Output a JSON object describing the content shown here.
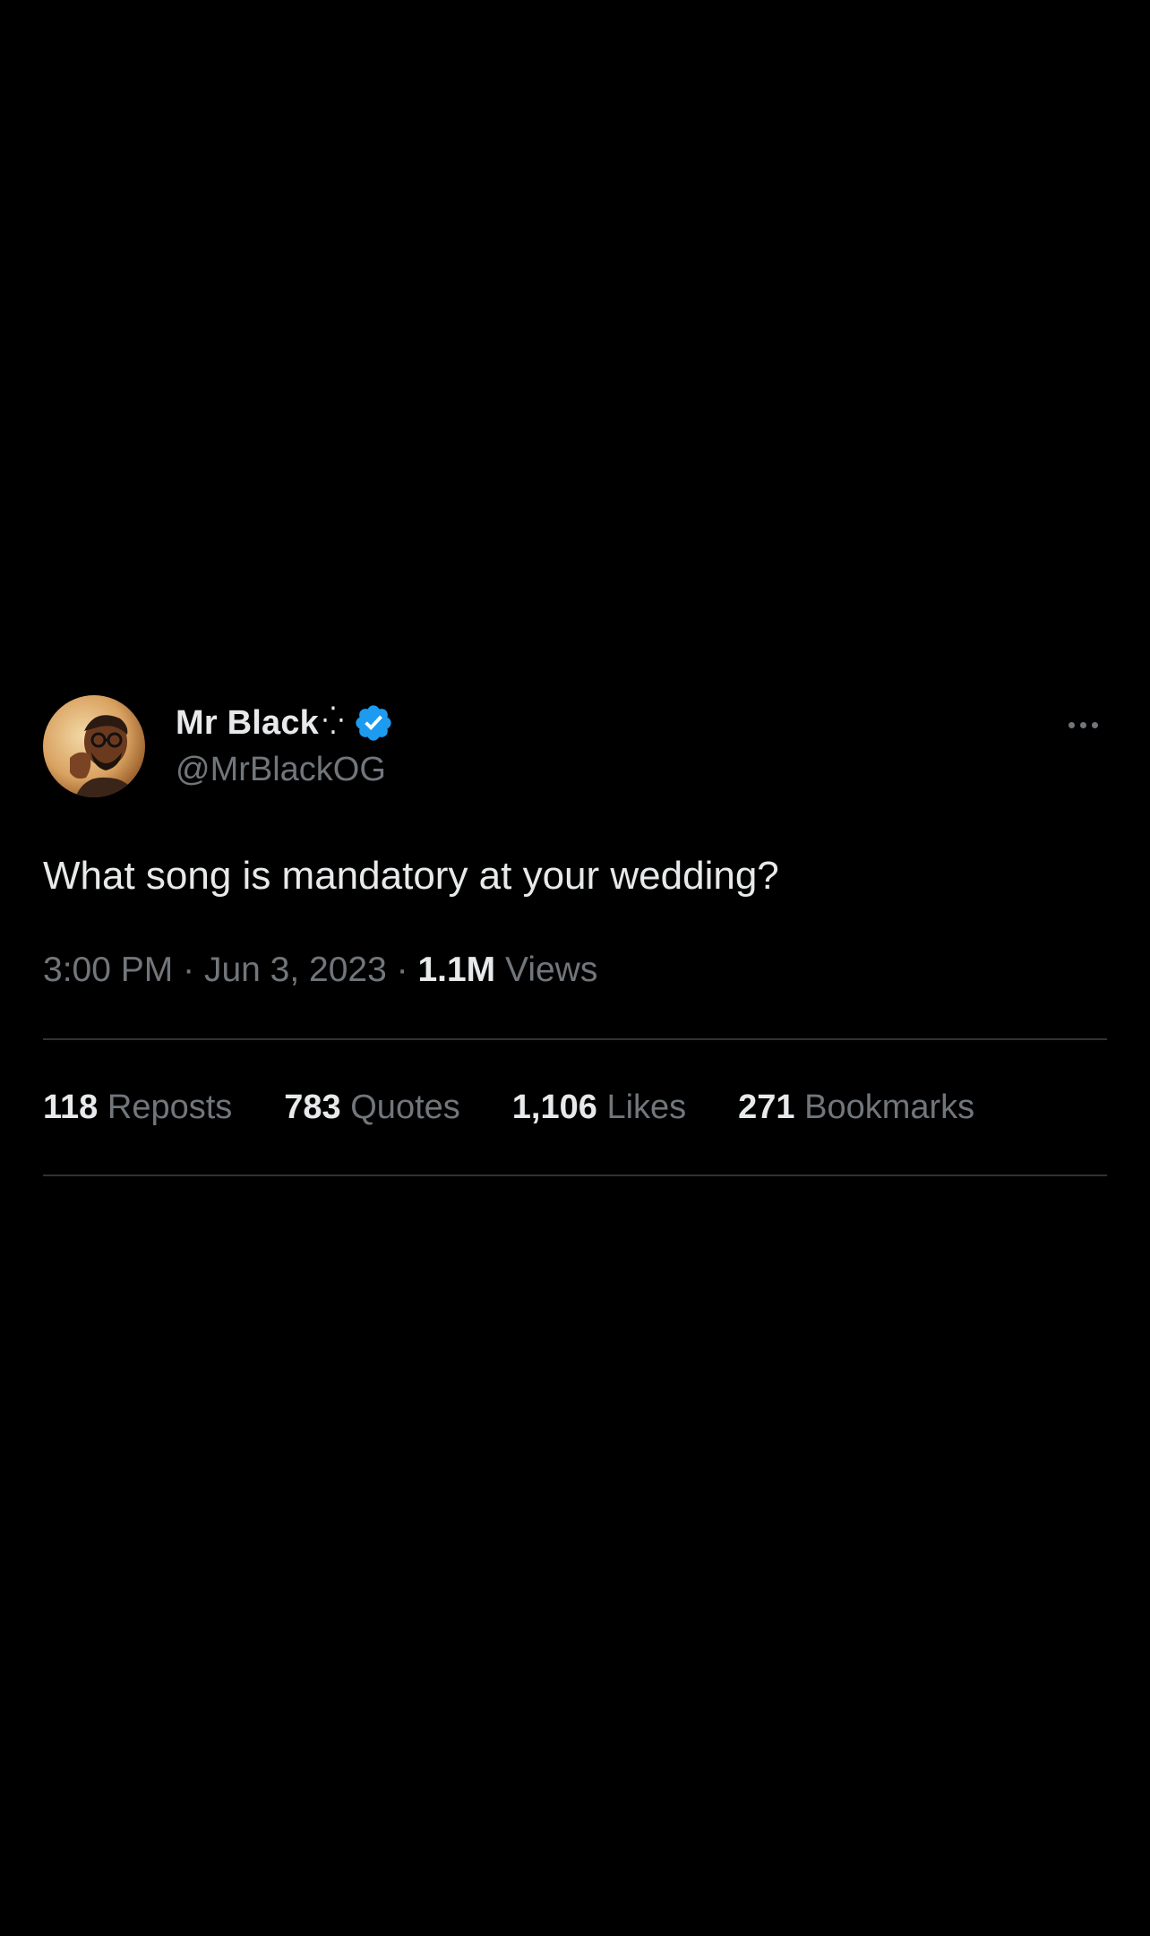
{
  "tweet": {
    "author": {
      "display_name": "Mr Black",
      "name_decoration": "⁛",
      "handle": "@MrBlackOG",
      "verified": true,
      "verified_color": "#1d9bf0"
    },
    "text": "What song is mandatory at your wedding?",
    "time": "3:00 PM",
    "separator": "·",
    "date": "Jun 3, 2023",
    "views_count": "1.1M",
    "views_label": "Views",
    "more_icon": "more-horizontal-icon",
    "stats": [
      {
        "count": "118",
        "label": "Reposts"
      },
      {
        "count": "783",
        "label": "Quotes"
      },
      {
        "count": "1,106",
        "label": "Likes"
      },
      {
        "count": "271",
        "label": "Bookmarks"
      }
    ]
  },
  "colors": {
    "background": "#000000",
    "primary_text": "#e7e9ea",
    "secondary_text": "#71767b",
    "divider": "#2f3336"
  }
}
